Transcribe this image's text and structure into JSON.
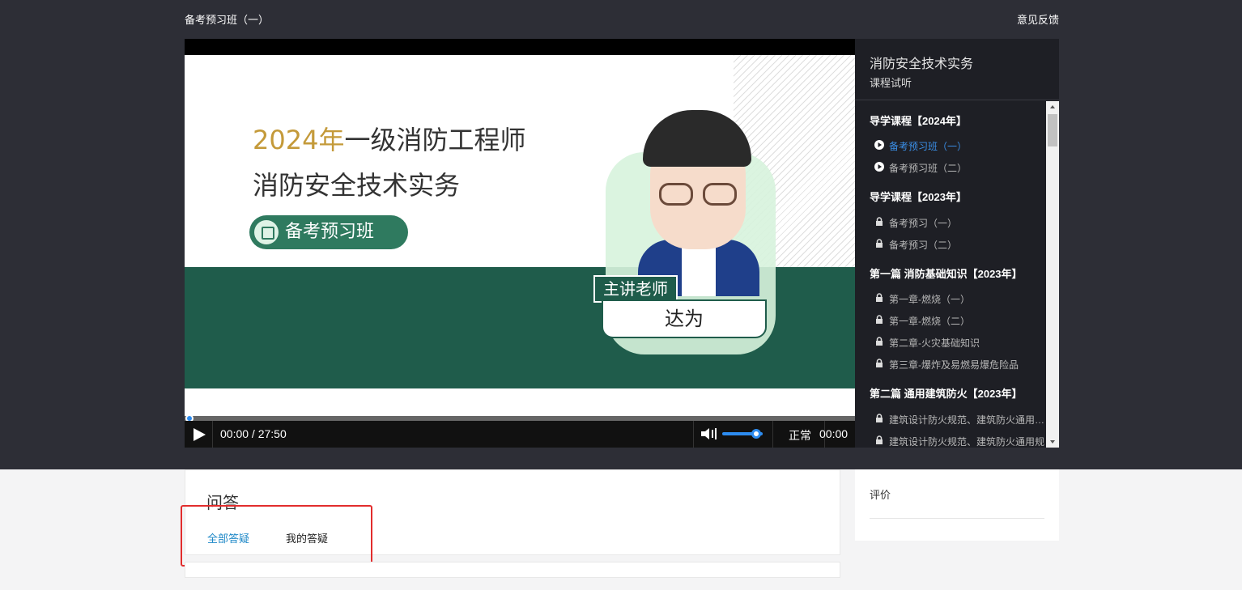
{
  "header": {
    "page_title": "备考预习班（一）",
    "feedback_label": "意见反馈"
  },
  "video": {
    "slide_year": "2024年",
    "slide_title_rest": "一级消防工程师",
    "slide_subtitle": "消防安全技术实务",
    "slide_badge": "备考预习班",
    "teacher_label": "主讲老师",
    "teacher_name": "达为",
    "time_display": "00:00 / 27:50",
    "rate_label": "正常",
    "time_right": "00:00",
    "progress_fraction": 0.0,
    "volume_fraction": 0.85,
    "colors": {
      "accent": "#c49a3a",
      "green": "#1f5c4b",
      "progress": "#2d8cf0"
    }
  },
  "side_panel": {
    "course_title": "消防安全技术实务",
    "course_subtitle": "课程试听",
    "sections": [
      {
        "title": "导学课程【2024年】",
        "items": [
          {
            "label": "备考预习班（一）",
            "icon": "play-circle-icon",
            "active": true
          },
          {
            "label": "备考预习班（二）",
            "icon": "play-circle-icon",
            "active": false
          }
        ]
      },
      {
        "title": "导学课程【2023年】",
        "items": [
          {
            "label": "备考预习（一）",
            "icon": "lock-icon",
            "active": false
          },
          {
            "label": "备考预习（二）",
            "icon": "lock-icon",
            "active": false
          }
        ]
      },
      {
        "title": "第一篇 消防基础知识【2023年】",
        "items": [
          {
            "label": "第一章-燃烧（一）",
            "icon": "lock-icon",
            "active": false
          },
          {
            "label": "第一章-燃烧（二）",
            "icon": "lock-icon",
            "active": false
          },
          {
            "label": "第二章-火灾基础知识",
            "icon": "lock-icon",
            "active": false
          },
          {
            "label": "第三章-爆炸及易燃易爆危险品",
            "icon": "lock-icon",
            "active": false
          }
        ]
      },
      {
        "title": "第二篇 通用建筑防火【2023年】",
        "items": [
          {
            "label": "建筑设计防火规范、建筑防火通用规范",
            "icon": "lock-icon",
            "active": false
          },
          {
            "label": "建筑设计防火规范、建筑防火通用规",
            "icon": "lock-icon",
            "active": false
          }
        ]
      }
    ]
  },
  "qa": {
    "title": "问答",
    "tabs": [
      {
        "label": "全部答疑",
        "active": true
      },
      {
        "label": "我的答疑",
        "active": false
      }
    ]
  },
  "evaluation": {
    "title": "评价"
  }
}
